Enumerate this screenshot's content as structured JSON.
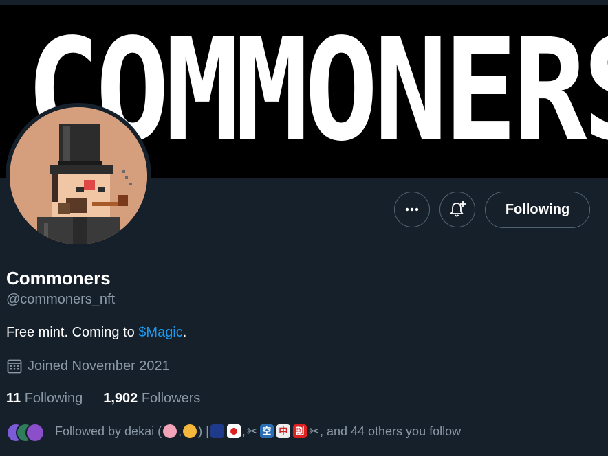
{
  "banner": {
    "text": "COMMONERS"
  },
  "actions": {
    "more_icon": "more-horizontal-icon",
    "bell_icon": "bell-plus-icon",
    "following_label": "Following"
  },
  "profile": {
    "name": "Commoners",
    "handle": "@commoners_nft",
    "bio_prefix": "Free mint. Coming to ",
    "bio_link": "$Magic",
    "bio_suffix": ".",
    "joined": "Joined November 2021",
    "following_count": "11",
    "following_label": "Following",
    "followers_count": "1,902",
    "followers_label": "Followers"
  },
  "followed_by": {
    "prefix": "Followed by dekai (",
    "sep1": ", ",
    "mid": ") | ",
    "sep2": ", ",
    "kanji1": "空",
    "kanji2": "中",
    "kanji3": "割",
    "suffix": ", and 44 others you follow"
  },
  "colors": {
    "background": "#15202b",
    "link": "#1d9bf0",
    "secondary_text": "#8b98a5",
    "border": "#536471"
  }
}
